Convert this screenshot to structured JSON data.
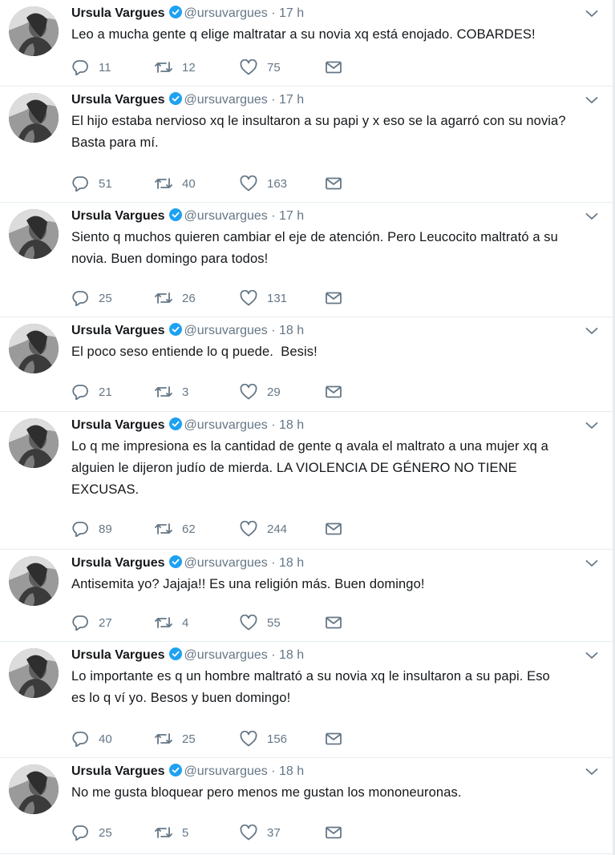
{
  "tweets": [
    {
      "name": "Ursula Vargues",
      "handle": "@ursuvargues",
      "dot": "·",
      "time": "17 h",
      "text": "Leo a mucha gente q elige maltratar a su novia xq está enojado. COBARDES!",
      "replies": "11",
      "retweets": "12",
      "likes": "75"
    },
    {
      "name": "Ursula Vargues",
      "handle": "@ursuvargues",
      "dot": "·",
      "time": "17 h",
      "text": "El hijo estaba nervioso xq le insultaron a su papi y x eso se la agarró con su novia?\nBasta para mí.",
      "replies": "51",
      "retweets": "40",
      "likes": "163"
    },
    {
      "name": "Ursula Vargues",
      "handle": "@ursuvargues",
      "dot": "·",
      "time": "17 h",
      "text": "Siento q muchos quieren cambiar el eje de atención. Pero Leucocito maltrató a su\nnovia. Buen domingo para todos!",
      "replies": "25",
      "retweets": "26",
      "likes": "131"
    },
    {
      "name": "Ursula Vargues",
      "handle": "@ursuvargues",
      "dot": "·",
      "time": "18 h",
      "text": "El poco seso entiende lo q puede.  Besis!",
      "replies": "21",
      "retweets": "3",
      "likes": "29"
    },
    {
      "name": "Ursula Vargues",
      "handle": "@ursuvargues",
      "dot": "·",
      "time": "18 h",
      "text": "Lo q me impresiona es la cantidad de gente q avala el maltrato a una mujer xq a\nalguien le dijeron judío de mierda. LA VIOLENCIA DE GÉNERO NO TIENE\nEXCUSAS.",
      "replies": "89",
      "retweets": "62",
      "likes": "244"
    },
    {
      "name": "Ursula Vargues",
      "handle": "@ursuvargues",
      "dot": "·",
      "time": "18 h",
      "text": "Antisemita yo? Jajaja!! Es una religión más. Buen domingo!",
      "replies": "27",
      "retweets": "4",
      "likes": "55"
    },
    {
      "name": "Ursula Vargues",
      "handle": "@ursuvargues",
      "dot": "·",
      "time": "18 h",
      "text": "Lo importante es q un hombre maltrató a su novia xq le insultaron a su papi. Eso\nes lo q ví yo. Besos y buen domingo!",
      "replies": "40",
      "retweets": "25",
      "likes": "156"
    },
    {
      "name": "Ursula Vargues",
      "handle": "@ursuvargues",
      "dot": "·",
      "time": "18 h",
      "text": "No me gusta bloquear pero menos me gustan los mononeuronas.",
      "replies": "25",
      "retweets": "5",
      "likes": "37"
    }
  ],
  "colors": {
    "text": "#14171a",
    "muted": "#657786",
    "verified": "#1da1f2",
    "divider": "#e6ecf0"
  },
  "icons": [
    "verified-badge-icon",
    "chevron-down-icon",
    "reply-icon",
    "retweet-icon",
    "like-icon",
    "direct-message-icon"
  ]
}
